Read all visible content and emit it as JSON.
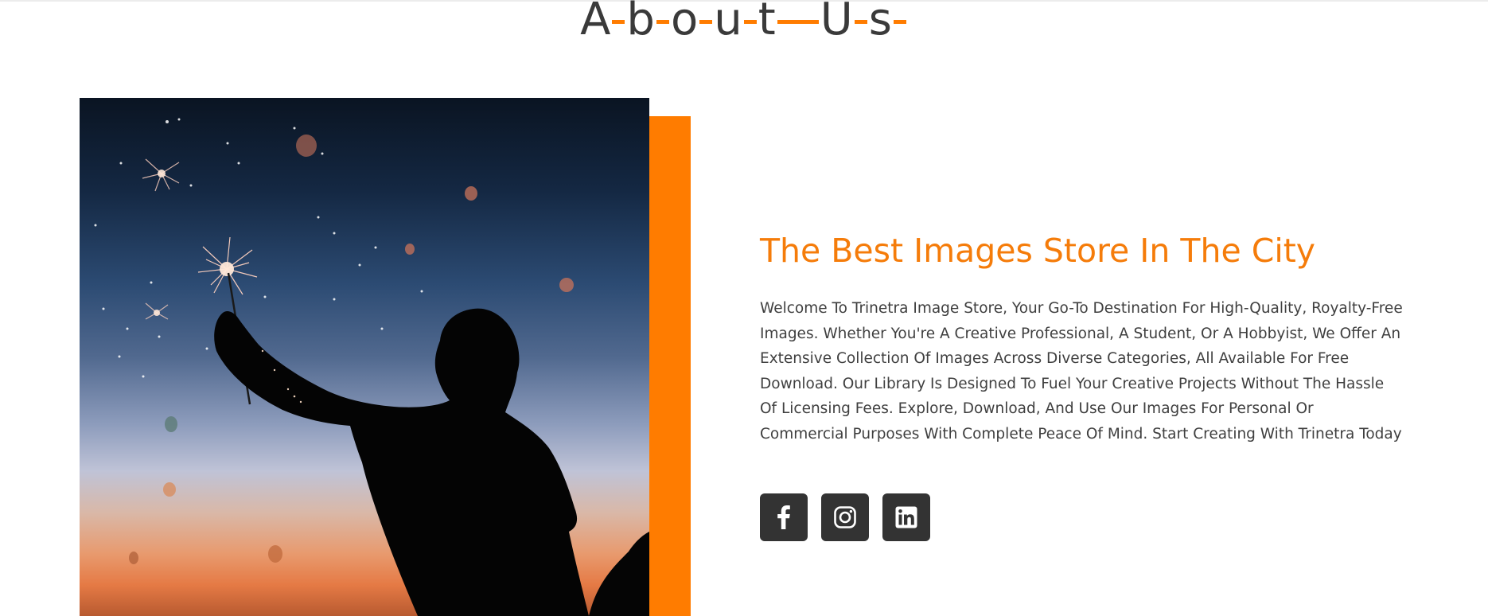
{
  "section": {
    "title_letters": [
      "A",
      "b",
      "o",
      "u",
      "t",
      "U",
      "s"
    ],
    "title_text": "About Us"
  },
  "about": {
    "headline": "The Best Images Store In The City",
    "paragraph": "Welcome To Trinetra Image Store, Your Go-To Destination For High-Quality, Royalty-Free Images. Whether You're A Creative Professional, A Student, Or A Hobbyist, We Offer An Extensive Collection Of Images Across Diverse Categories, All Available For Free Download. Our Library Is Designed To Fuel Your Creative Projects Without The Hassle Of Licensing Fees. Explore, Download, And Use Our Images For Personal Or Commercial Purposes With Complete Peace Of Mind. Start Creating With Trinetra Today"
  },
  "social": [
    {
      "icon": "facebook-icon"
    },
    {
      "icon": "instagram-icon"
    },
    {
      "icon": "linkedin-icon"
    }
  ],
  "colors": {
    "accent": "#ff7c00",
    "headline": "#f57c0a",
    "text": "#3f3f3f",
    "button_bg": "#333333"
  }
}
